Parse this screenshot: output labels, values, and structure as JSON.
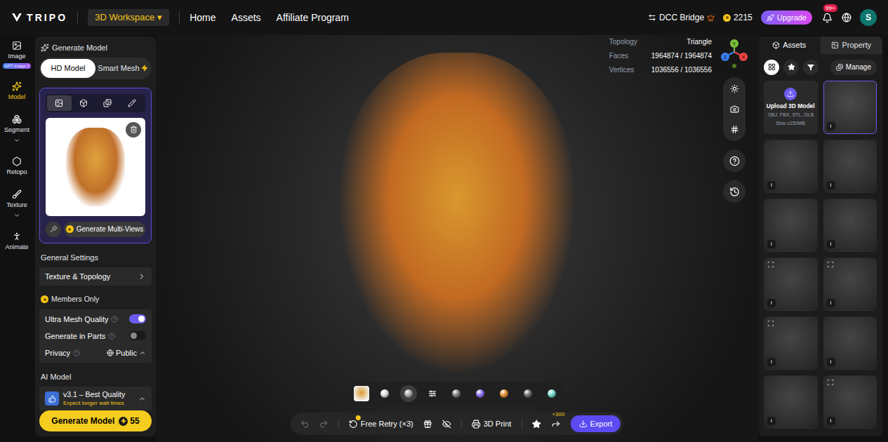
{
  "topbar": {
    "logo": "TRIPO",
    "workspace": "3D Workspace",
    "workspace_caret": "▾",
    "nav": [
      {
        "label": "Home"
      },
      {
        "label": "Assets"
      },
      {
        "label": "Affiliate Program"
      }
    ],
    "dcc_bridge": "DCC Bridge",
    "credits": "2215",
    "upgrade": "Upgrade",
    "notifications": "99+",
    "avatar": "S"
  },
  "rail": [
    {
      "label": "Image",
      "badge": "GPT Image 1",
      "selected": false,
      "expandable": false
    },
    {
      "label": "Model",
      "badge": "",
      "selected": true,
      "expandable": false
    },
    {
      "label": "Segment",
      "badge": "",
      "selected": false,
      "expandable": true
    },
    {
      "label": "Retopo",
      "badge": "",
      "selected": false,
      "expandable": false
    },
    {
      "label": "Texture",
      "badge": "",
      "selected": false,
      "expandable": true
    },
    {
      "label": "Animate",
      "badge": "",
      "selected": false,
      "expandable": false
    }
  ],
  "panel": {
    "title": "Generate Model",
    "modes": [
      {
        "label": "HD Model",
        "selected": true
      },
      {
        "label": "Smart Mesh",
        "selected": false
      }
    ],
    "input_tabs": [
      {
        "selected": true
      },
      {
        "selected": false
      },
      {
        "selected": false
      },
      {
        "selected": false
      }
    ],
    "multiview_button": "Generate Multi-Views",
    "general_settings": "General Settings",
    "texture_topology": "Texture & Topology",
    "members_only": "Members Only",
    "toggles": [
      {
        "label": "Ultra Mesh Quality",
        "on": true
      },
      {
        "label": "Generate in Parts",
        "on": false
      }
    ],
    "privacy": {
      "label": "Privacy",
      "value": "Public"
    },
    "ai_model": {
      "heading": "AI Model",
      "name": "v3.1 – Best Quality",
      "note": "Expect longer wait times"
    },
    "generate": {
      "label": "Generate Model",
      "cost": "55"
    }
  },
  "viewport": {
    "stats": [
      {
        "label": "Topology",
        "value": "Triangle"
      },
      {
        "label": "Faces",
        "value": "1964874 / 1964874"
      },
      {
        "label": "Vertices",
        "value": "1036556 / 1036556"
      }
    ],
    "axes": [
      {
        "label": "Y",
        "color": "#7cc33a"
      },
      {
        "label": "Z",
        "color": "#3b82f6"
      },
      {
        "label": "X",
        "color": "#ef4444"
      }
    ]
  },
  "render_modes": [
    {
      "kind": "sphere",
      "color": "#d9d9d9",
      "selected": false
    },
    {
      "kind": "sphere",
      "color": "#a3a3a3",
      "selected": true
    },
    {
      "kind": "settings",
      "color": "#ffffff",
      "selected": false
    },
    {
      "kind": "sphere",
      "color": "#7a7a7a",
      "selected": false
    },
    {
      "kind": "sphere",
      "color": "#8b6cf0",
      "selected": false
    },
    {
      "kind": "sphere",
      "color": "#e08a2c",
      "selected": false
    },
    {
      "kind": "sphere",
      "color": "#6b6b6b",
      "selected": false
    },
    {
      "kind": "sphere",
      "color": "#6fd6c8",
      "selected": false
    }
  ],
  "actions": {
    "history": [
      {
        "disabled": true
      },
      {
        "disabled": true
      }
    ],
    "free_retry": "Free Retry (×3)",
    "print": "3D Print",
    "share_bonus": "+300",
    "export": "Export"
  },
  "sidebar": {
    "tabs": [
      {
        "label": "Assets",
        "selected": true
      },
      {
        "label": "Property",
        "selected": false
      }
    ],
    "filters": [
      {
        "selected": true
      },
      {
        "selected": false
      },
      {
        "selected": false
      }
    ],
    "manage": "Manage",
    "upload": {
      "title": "Upload 3D Model",
      "formats": "OBJ, FBX, STL, GLB",
      "size": "Size ≤150MB"
    },
    "assets": [
      {
        "info": "i",
        "selected": true,
        "marked": false
      },
      {
        "info": "i",
        "selected": false,
        "marked": false
      },
      {
        "info": "i",
        "selected": false,
        "marked": false
      },
      {
        "info": "i",
        "selected": false,
        "marked": false
      },
      {
        "info": "i",
        "selected": false,
        "marked": false
      },
      {
        "info": "i",
        "selected": false,
        "marked": true
      },
      {
        "info": "i",
        "selected": false,
        "marked": true
      },
      {
        "info": "i",
        "selected": false,
        "marked": true
      },
      {
        "info": "i",
        "selected": false,
        "marked": false
      },
      {
        "info": "i",
        "selected": false,
        "marked": false
      },
      {
        "info": "i",
        "selected": false,
        "marked": true
      }
    ]
  }
}
